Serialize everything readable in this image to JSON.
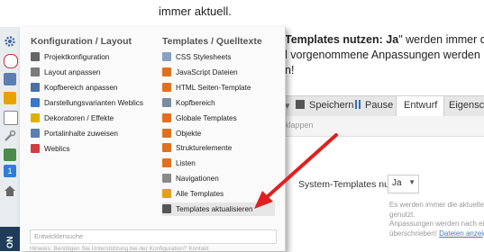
{
  "background": {
    "top_text": "immer aktuell.",
    "para_line1_bold": "Templates nutzen: Ja",
    "para_line1_rest": "\" werden immer die a",
    "para_line2": "l vorgenommene Anpassungen werden r",
    "para_line3": "n!"
  },
  "toolbar": {
    "save_label": "Speichern",
    "pause_label": "Pause",
    "draft_tab": "Entwurf",
    "properties_tab": "Eigenschafte",
    "collapse_label": "klappen"
  },
  "settings": {
    "system_templates_label": "System-Templates nutzen",
    "system_templates_value": "Ja",
    "help_line1": "Es werden immer die aktuellen D",
    "help_line2": "genutzt.",
    "help_line3": "Anpassungen werden nach eine",
    "help_line4": "überschrieben!",
    "help_link": "Dateien anzeige"
  },
  "menu": {
    "col1_title": "Konfiguration / Layout",
    "col2_title": "Templates / Quelltexte",
    "col1_items": [
      {
        "label": "Projektkonfiguration",
        "icon": "sliders-icon",
        "color": "#666666"
      },
      {
        "label": "Layout anpassen",
        "icon": "layout-icon",
        "color": "#7a7a7a"
      },
      {
        "label": "Kopfbereich anpassen",
        "icon": "header-icon",
        "color": "#4a6fa5"
      },
      {
        "label": "Darstellungsvarianten Weblics",
        "icon": "variants-icon",
        "color": "#3a78c9"
      },
      {
        "label": "Dekoratoren / Effekte",
        "icon": "decorator-icon",
        "color": "#e0b000"
      },
      {
        "label": "Portalinhalte zuweisen",
        "icon": "portal-icon",
        "color": "#5b7fb0"
      },
      {
        "label": "Weblics",
        "icon": "weblics-icon",
        "color": "#d04040"
      }
    ],
    "col2_items": [
      {
        "label": "CSS Stylesheets",
        "icon": "css-icon",
        "color": "#8aa0c0"
      },
      {
        "label": "JavaScript Dateien",
        "icon": "js-icon",
        "color": "#e07020"
      },
      {
        "label": "HTML Seiten-Template",
        "icon": "html-icon",
        "color": "#e07020"
      },
      {
        "label": "Kopfbereich",
        "icon": "header-icon",
        "color": "#7a8aa0"
      },
      {
        "label": "Globale Templates",
        "icon": "global-icon",
        "color": "#e07020"
      },
      {
        "label": "Objekte",
        "icon": "objects-icon",
        "color": "#e07020"
      },
      {
        "label": "Strukturelemente",
        "icon": "structure-icon",
        "color": "#e07020"
      },
      {
        "label": "Listen",
        "icon": "list-icon",
        "color": "#e07020"
      },
      {
        "label": "Navigationen",
        "icon": "navigation-icon",
        "color": "#8a8a8a"
      },
      {
        "label": "Alle Templates",
        "icon": "all-templates-icon",
        "color": "#e0a020"
      },
      {
        "label": "Templates aktualisieren",
        "icon": "refresh-icon",
        "color": "#555555"
      }
    ],
    "search_placeholder": "Entwicklersuche",
    "footer_text": "Hinweis: Benötigen Sie Unterstützung bei der Konfiguration? Kontakt"
  },
  "sidebar": {
    "label": "ON",
    "badge": "1"
  }
}
